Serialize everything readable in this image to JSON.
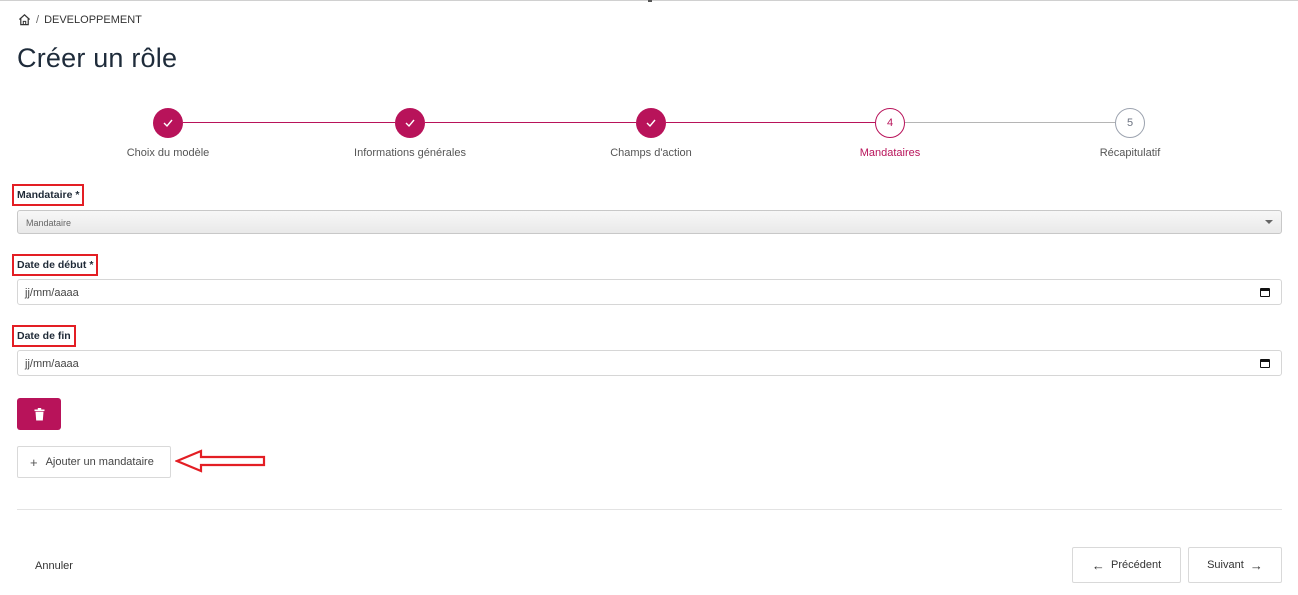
{
  "breadcrumb": {
    "section": "DEVELOPPEMENT"
  },
  "page": {
    "title": "Créer un rôle"
  },
  "stepper": {
    "steps": [
      {
        "label": "Choix du modèle",
        "state": "done",
        "number": ""
      },
      {
        "label": "Informations générales",
        "state": "done",
        "number": ""
      },
      {
        "label": "Champs d'action",
        "state": "done",
        "number": ""
      },
      {
        "label": "Mandataires",
        "state": "current",
        "number": "4"
      },
      {
        "label": "Récapitulatif",
        "state": "todo",
        "number": "5"
      }
    ]
  },
  "form": {
    "mandataire_label": "Mandataire *",
    "mandataire_value": "Mandataire",
    "date_debut_label": "Date de début *",
    "date_debut_placeholder": "jj/mm/aaaa",
    "date_fin_label": "Date de fin",
    "date_fin_placeholder": "jj/mm/aaaa",
    "add_label": "Ajouter un mandataire"
  },
  "footer": {
    "cancel_label": "Annuler",
    "previous_label": "Précédent",
    "next_label": "Suivant"
  },
  "colors": {
    "accent": "#b8135a",
    "annotation": "#e31e24",
    "todo_step": "#9ca3af"
  }
}
